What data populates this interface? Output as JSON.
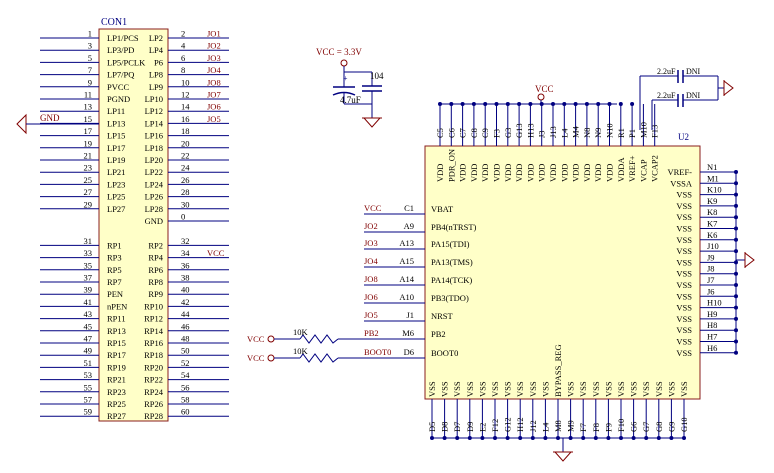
{
  "colors": {
    "background": "#ffffff",
    "body_fill": "#ffffc8",
    "body_stroke": "#8a1c1c",
    "wire": "#000080",
    "net_label": "#800000",
    "designator": "#000080",
    "pin_text": "#000000",
    "junction": "#000080",
    "power": "#800000",
    "label_red": "#a00000"
  },
  "con1": {
    "designator": "CON1",
    "rows": [
      {
        "ln": "1",
        "lt": "LP1/PCS",
        "rt": "LP2",
        "rn": "2",
        "net": "JO1"
      },
      {
        "ln": "3",
        "lt": "LP3/PD",
        "rt": "LP4",
        "rn": "4",
        "net": "JO2"
      },
      {
        "ln": "5",
        "lt": "LP5/PCLK",
        "rt": "P6",
        "rn": "6",
        "net": "JO3"
      },
      {
        "ln": "7",
        "lt": "LP7/PQ",
        "rt": "LP8",
        "rn": "8",
        "net": "JO4"
      },
      {
        "ln": "9",
        "lt": "PVCC",
        "rt": "LP9",
        "rn": "10",
        "net": "JO8"
      },
      {
        "ln": "11",
        "lt": "PGND",
        "rt": "LP10",
        "rn": "12",
        "net": "JO7"
      },
      {
        "ln": "13",
        "lt": "LP11",
        "rt": "LP12",
        "rn": "14",
        "net": "JO6"
      },
      {
        "ln": "15",
        "lt": "LP13",
        "rt": "LP14",
        "rn": "16",
        "net": "JO5"
      },
      {
        "ln": "17",
        "lt": "LP15",
        "rt": "LP16",
        "rn": "18",
        "net": ""
      },
      {
        "ln": "19",
        "lt": "LP17",
        "rt": "LP18",
        "rn": "20",
        "net": ""
      },
      {
        "ln": "21",
        "lt": "LP19",
        "rt": "LP20",
        "rn": "22",
        "net": ""
      },
      {
        "ln": "23",
        "lt": "LP21",
        "rt": "LP22",
        "rn": "24",
        "net": ""
      },
      {
        "ln": "25",
        "lt": "LP23",
        "rt": "LP24",
        "rn": "26",
        "net": ""
      },
      {
        "ln": "27",
        "lt": "LP25",
        "rt": "LP26",
        "rn": "28",
        "net": ""
      },
      {
        "ln": "29",
        "lt": "LP27",
        "rt": "LP28",
        "rn": "30",
        "net": ""
      },
      {
        "ln": "",
        "lt": "",
        "rt": "GND",
        "rn": "0",
        "net": ""
      },
      {
        "ln": "",
        "lt": "",
        "rt": "",
        "rn": "",
        "net": ""
      },
      {
        "ln": "31",
        "lt": "RP1",
        "rt": "RP2",
        "rn": "32",
        "net": ""
      },
      {
        "ln": "33",
        "lt": "RP3",
        "rt": "RP4",
        "rn": "34",
        "net": "VCC"
      },
      {
        "ln": "35",
        "lt": "RP5",
        "rt": "RP6",
        "rn": "36",
        "net": ""
      },
      {
        "ln": "37",
        "lt": "RP7",
        "rt": "RP8",
        "rn": "38",
        "net": ""
      },
      {
        "ln": "39",
        "lt": "PEN",
        "rt": "RP9",
        "rn": "40",
        "net": ""
      },
      {
        "ln": "41",
        "lt": "nPEN",
        "rt": "RP10",
        "rn": "42",
        "net": ""
      },
      {
        "ln": "43",
        "lt": "RP11",
        "rt": "RP12",
        "rn": "44",
        "net": ""
      },
      {
        "ln": "45",
        "lt": "RP13",
        "rt": "RP14",
        "rn": "46",
        "net": ""
      },
      {
        "ln": "47",
        "lt": "RP15",
        "rt": "RP16",
        "rn": "48",
        "net": ""
      },
      {
        "ln": "49",
        "lt": "RP17",
        "rt": "RP18",
        "rn": "50",
        "net": ""
      },
      {
        "ln": "51",
        "lt": "RP19",
        "rt": "RP20",
        "rn": "52",
        "net": ""
      },
      {
        "ln": "53",
        "lt": "RP21",
        "rt": "RP22",
        "rn": "54",
        "net": ""
      },
      {
        "ln": "55",
        "lt": "RP23",
        "rt": "RP24",
        "rn": "56",
        "net": ""
      },
      {
        "ln": "57",
        "lt": "RP25",
        "rt": "RP26",
        "rn": "58",
        "net": ""
      },
      {
        "ln": "59",
        "lt": "RP27",
        "rt": "RP28",
        "rn": "60",
        "net": ""
      }
    ]
  },
  "gnd_label": "GND",
  "power_block": {
    "vcc_label": "VCC = 3.3V",
    "cap1_label": "4.7uF",
    "cap2_label": "104"
  },
  "top_caps": [
    {
      "label": "2.2uF",
      "suffix": "DNI"
    },
    {
      "label": "2.2uF",
      "suffix": "DNI"
    }
  ],
  "u2": {
    "designator": "U2",
    "vcc_top": "VCC",
    "top_pins": [
      {
        "ball": "C5",
        "name": "VDD"
      },
      {
        "ball": "C6",
        "name": "PDR_ON"
      },
      {
        "ball": "C7",
        "name": "VDD"
      },
      {
        "ball": "C8",
        "name": "VDD"
      },
      {
        "ball": "C9",
        "name": "VDD"
      },
      {
        "ball": "F3",
        "name": "VDD"
      },
      {
        "ball": "G3",
        "name": "VDD"
      },
      {
        "ball": "G13",
        "name": "VDD"
      },
      {
        "ball": "H13",
        "name": "VDD"
      },
      {
        "ball": "J3",
        "name": "VDD"
      },
      {
        "ball": "J13",
        "name": "VDD"
      },
      {
        "ball": "L4",
        "name": "VDD"
      },
      {
        "ball": "M4",
        "name": "VDD"
      },
      {
        "ball": "N8",
        "name": "VDD"
      },
      {
        "ball": "N9",
        "name": "VDD"
      },
      {
        "ball": "N10",
        "name": "VDD"
      },
      {
        "ball": "R1",
        "name": "VDDA"
      },
      {
        "ball": "P1",
        "name": "VREF+"
      },
      {
        "ball": "M10",
        "name": "VCAP"
      },
      {
        "ball": "F13",
        "name": "VCAP2"
      }
    ],
    "bottom_pins": [
      {
        "ball": "D5",
        "name": "VSS"
      },
      {
        "ball": "D8",
        "name": "VSS"
      },
      {
        "ball": "D7",
        "name": "VSS"
      },
      {
        "ball": "D9",
        "name": "VSS"
      },
      {
        "ball": "E2",
        "name": "VSS"
      },
      {
        "ball": "F12",
        "name": "VSS"
      },
      {
        "ball": "G12",
        "name": "VSS"
      },
      {
        "ball": "H12",
        "name": "VSS"
      },
      {
        "ball": "J12",
        "name": "VSS"
      },
      {
        "ball": "L4",
        "name": "VSS"
      },
      {
        "ball": "M8",
        "name": "BYPASS_REG"
      },
      {
        "ball": "M9",
        "name": "VSS"
      },
      {
        "ball": "F7",
        "name": "VSS"
      },
      {
        "ball": "F8",
        "name": "VSS"
      },
      {
        "ball": "F9",
        "name": "VSS"
      },
      {
        "ball": "F10",
        "name": "VSS"
      },
      {
        "ball": "G6",
        "name": "VSS"
      },
      {
        "ball": "G7",
        "name": "VSS"
      },
      {
        "ball": "G8",
        "name": "VSS"
      },
      {
        "ball": "G9",
        "name": "VSS"
      },
      {
        "ball": "G10",
        "name": "VSS"
      }
    ],
    "left_pins": [
      {
        "net": "VCC",
        "ball": "C1",
        "name": "VBAT"
      },
      {
        "net": "JO2",
        "ball": "A9",
        "name": "PB4(nTRST)"
      },
      {
        "net": "JO3",
        "ball": "A13",
        "name": "PA15(TDI)"
      },
      {
        "net": "JO4",
        "ball": "A15",
        "name": "PA13(TMS)"
      },
      {
        "net": "JO8",
        "ball": "A14",
        "name": "PA14(TCK)"
      },
      {
        "net": "JO6",
        "ball": "A10",
        "name": "PB3(TDO)"
      },
      {
        "net": "JO5",
        "ball": "J1",
        "name": "NRST"
      },
      {
        "net": "PB2",
        "ball": "M6",
        "name": "PB2"
      },
      {
        "net": "BOOT0",
        "ball": "D6",
        "name": "BOOT0"
      }
    ],
    "right_pins": [
      {
        "ball": "N1",
        "name": "VREF-"
      },
      {
        "ball": "M1",
        "name": "VSSA"
      },
      {
        "ball": "K10",
        "name": "VSS"
      },
      {
        "ball": "K9",
        "name": "VSS"
      },
      {
        "ball": "K8",
        "name": "VSS"
      },
      {
        "ball": "K7",
        "name": "VSS"
      },
      {
        "ball": "K6",
        "name": "VSS"
      },
      {
        "ball": "J10",
        "name": "VSS"
      },
      {
        "ball": "J9",
        "name": "VSS"
      },
      {
        "ball": "J8",
        "name": "VSS"
      },
      {
        "ball": "J7",
        "name": "VSS"
      },
      {
        "ball": "J6",
        "name": "VSS"
      },
      {
        "ball": "H10",
        "name": "VSS"
      },
      {
        "ball": "H9",
        "name": "VSS"
      },
      {
        "ball": "H8",
        "name": "VSS"
      },
      {
        "ball": "H7",
        "name": "VSS"
      },
      {
        "ball": "H6",
        "name": "VSS"
      }
    ]
  },
  "resistors": [
    {
      "vcc": "VCC",
      "value": "10K"
    },
    {
      "vcc": "VCC",
      "value": "10K"
    }
  ]
}
